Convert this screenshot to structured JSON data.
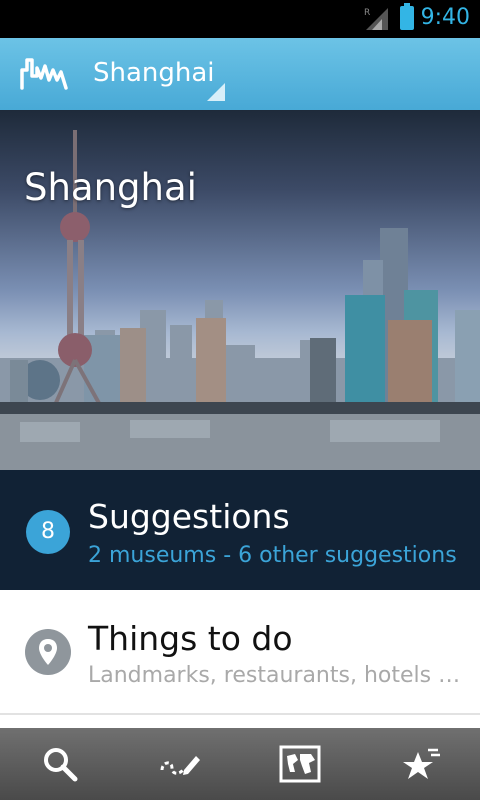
{
  "status_bar": {
    "time": "9:40",
    "network_label": "R"
  },
  "app_bar": {
    "title": "Shanghai",
    "logo": "city-skyline-icon"
  },
  "hero": {
    "title": "Shanghai"
  },
  "suggestions": {
    "count": "8",
    "title": "Suggestions",
    "subtitle": "2 museums - 6 other suggestions"
  },
  "things_to_do": {
    "title": "Things to do",
    "subtitle": "Landmarks, restaurants, hotels …",
    "icon": "map-pin-icon"
  },
  "bottom_nav": [
    {
      "icon": "search-icon"
    },
    {
      "icon": "edit-route-icon"
    },
    {
      "icon": "world-map-icon"
    },
    {
      "icon": "favorites-star-icon"
    }
  ],
  "colors": {
    "accent": "#33b5e5",
    "app_bar": "#48a9d6",
    "suggestions_bg": "#112235",
    "badge": "#3ba4d8"
  }
}
